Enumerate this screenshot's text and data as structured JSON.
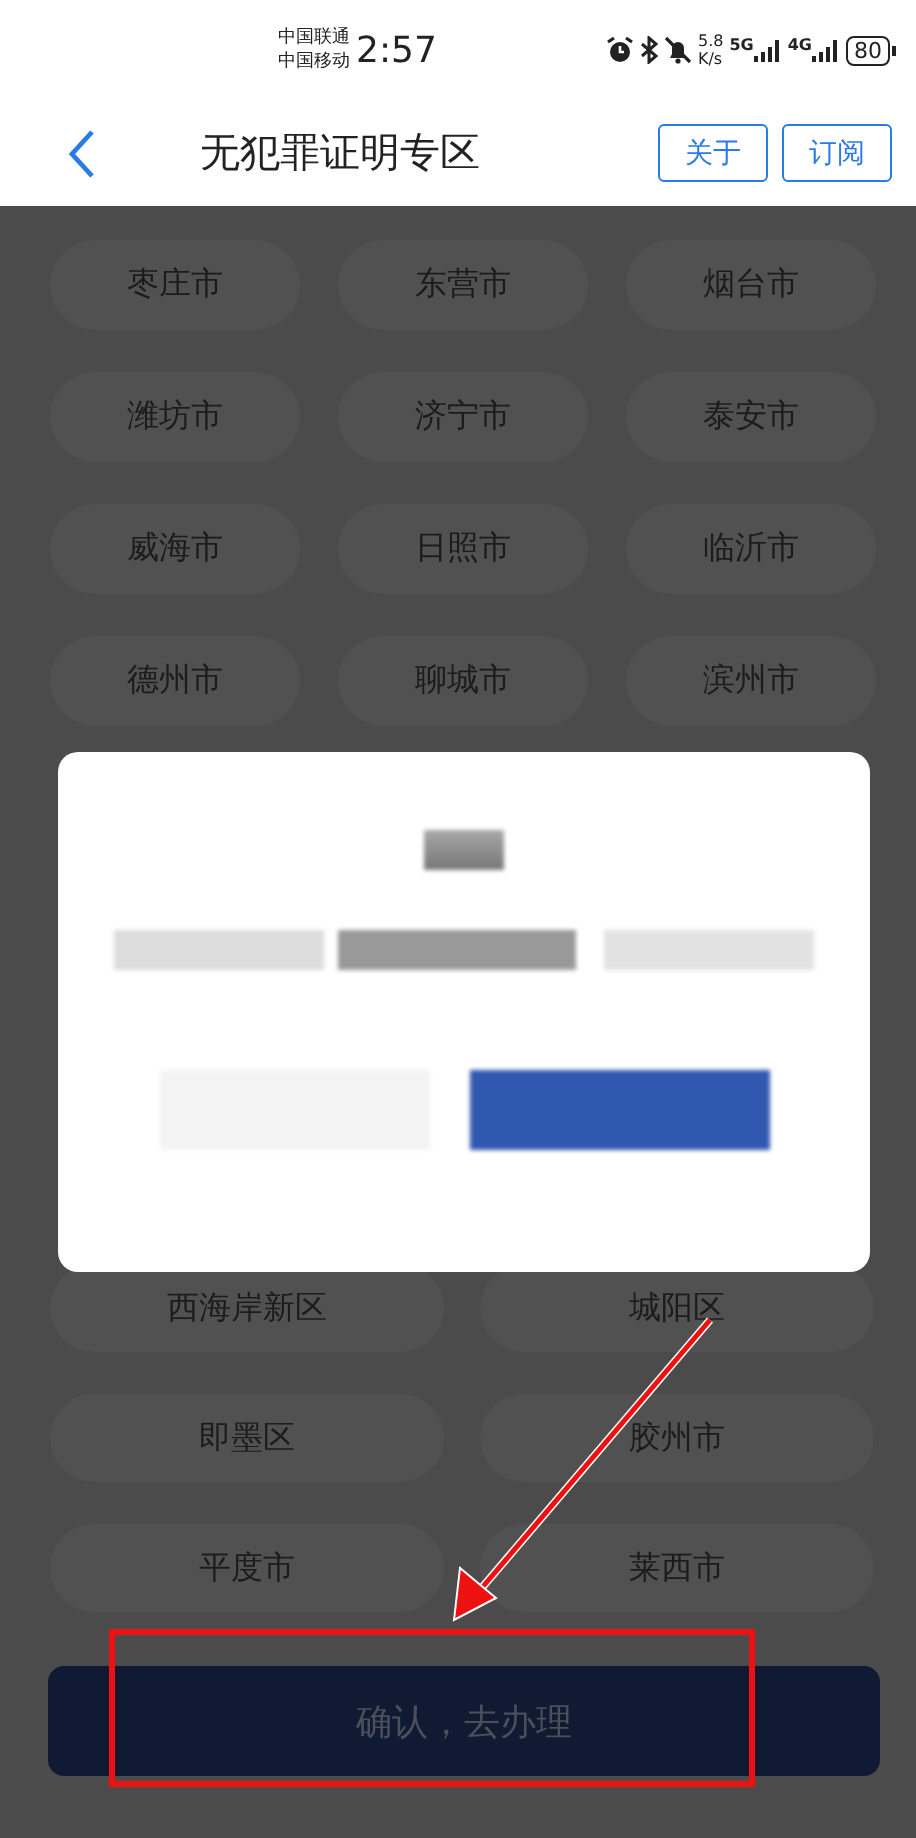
{
  "status_bar": {
    "carriers": [
      "中国联通",
      "中国移动"
    ],
    "time": "2:57",
    "net_speed": {
      "value": "5.8",
      "unit": "K/s"
    },
    "networks": [
      "5G",
      "4G"
    ],
    "battery": "80"
  },
  "header": {
    "title": "无犯罪证明专区",
    "buttons": [
      "关于",
      "订阅"
    ]
  },
  "cities": [
    "枣庄市",
    "东营市",
    "烟台市",
    "潍坊市",
    "济宁市",
    "泰安市",
    "威海市",
    "日照市",
    "临沂市",
    "德州市",
    "聊城市",
    "滨州市"
  ],
  "districts": [
    "西海岸新区",
    "城阳区",
    "即墨区",
    "胶州市",
    "平度市",
    "莱西市"
  ],
  "confirm_button": "确认，去办理"
}
